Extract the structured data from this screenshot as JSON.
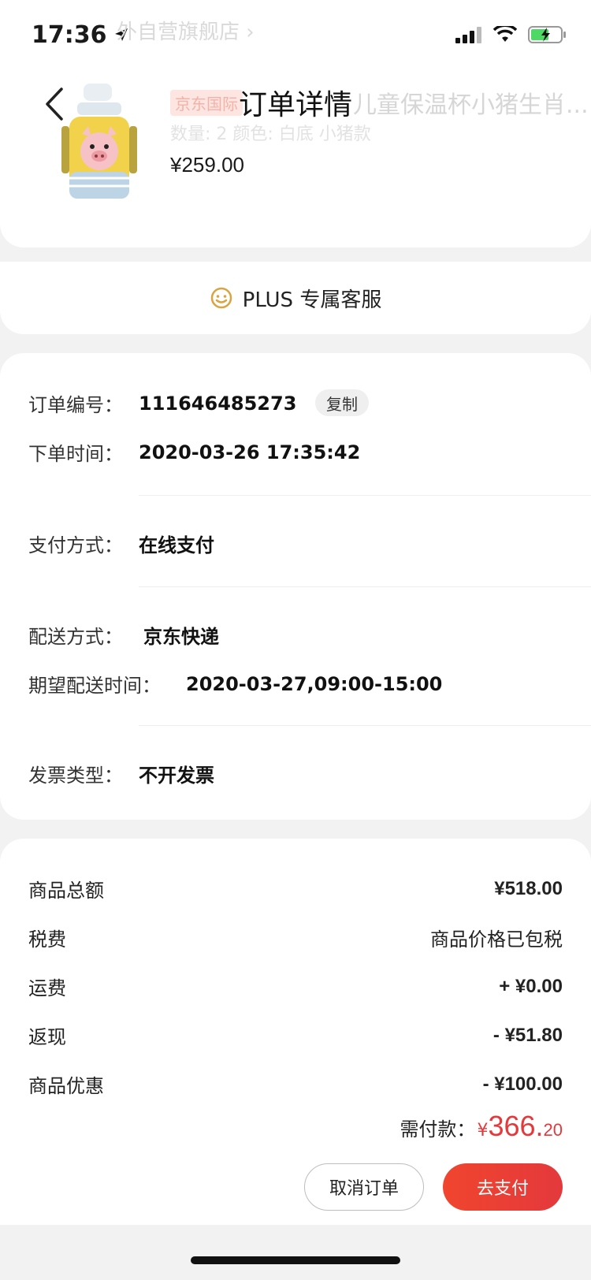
{
  "status_bar": {
    "time": "17:36"
  },
  "header": {
    "title": "订单详情",
    "store_name_faded": "外自营旗舰店 ›",
    "product_tag_faded": "京东国际",
    "product_name_faded": "儿童保温杯小猪生肖...",
    "product_spec_faded": "数量: 2  颜色: 白底 小猪款",
    "product_price": "¥259.00"
  },
  "service": {
    "label": "PLUS 专属客服"
  },
  "order_info": {
    "order_no_label": "订单编号：",
    "order_no": "111646485273",
    "copy_label": "复制",
    "order_time_label": "下单时间：",
    "order_time": "2020-03-26 17:35:42",
    "payment_label": "支付方式：",
    "payment": "在线支付",
    "delivery_label": "配送方式：",
    "delivery": "京东快递",
    "expected_label": "期望配送时间：",
    "expected": "2020-03-27,09:00-15:00",
    "invoice_label": "发票类型：",
    "invoice": "不开发票"
  },
  "totals": {
    "subtotal_label": "商品总额",
    "subtotal": "¥518.00",
    "tax_label": "税费",
    "tax": "商品价格已包税",
    "shipping_label": "运费",
    "shipping": "+ ¥0.00",
    "cashback_label": "返现",
    "cashback": "- ¥51.80",
    "discount_label": "商品优惠",
    "discount": "- ¥100.00",
    "payable_label": "需付款：",
    "payable_currency": "¥",
    "payable_int": "366.",
    "payable_dec": "20"
  },
  "actions": {
    "cancel": "取消订单",
    "pay": "去支付"
  },
  "colors": {
    "accent": "#e4393c",
    "plus_gold": "#d9a441"
  }
}
